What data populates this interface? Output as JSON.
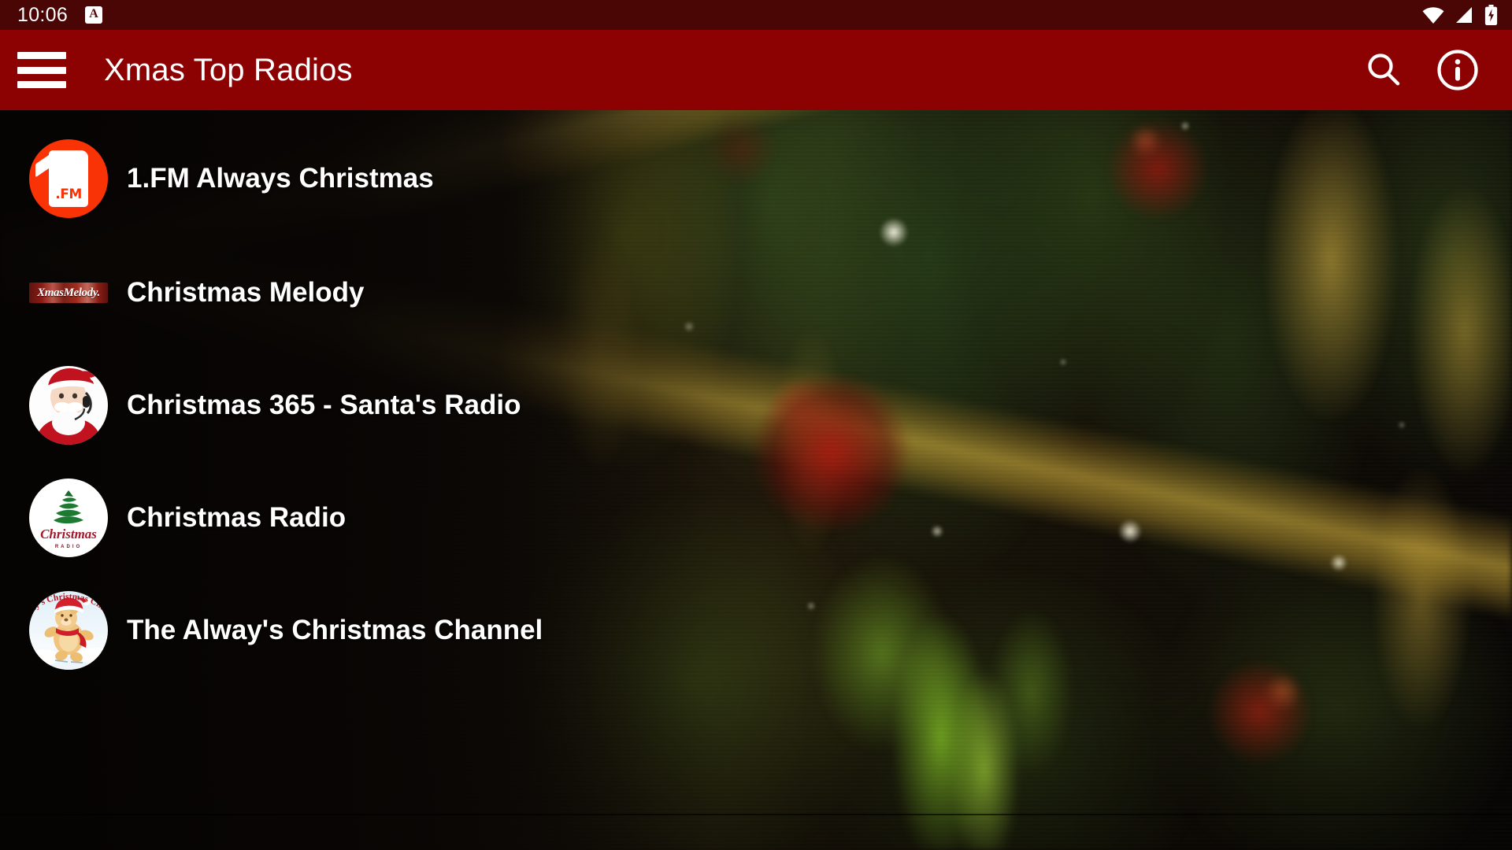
{
  "status_bar": {
    "time": "10:06",
    "notification_icon_letter": "A",
    "icons": [
      "wifi-icon",
      "cellular-signal-icon",
      "battery-charging-icon"
    ],
    "background_color": "#4a0505"
  },
  "app_bar": {
    "menu_icon": "hamburger-menu-icon",
    "title": "Xmas Top Radios",
    "search_icon": "search-icon",
    "info_icon": "info-icon",
    "background_color": "#8c0202",
    "text_color": "#ffffff"
  },
  "list": {
    "items": [
      {
        "name": "1.FM  Always Christmas",
        "logo": "one-fm-logo",
        "logo_text": ".FM",
        "logo_color": "#f93305"
      },
      {
        "name": "Christmas Melody",
        "logo": "xmas-melody-logo",
        "logo_text": "XmasMelody.",
        "logo_color": "#8d1b14"
      },
      {
        "name": "Christmas 365 - Santa's Radio",
        "logo": "santa-radio-logo",
        "logo_color": "#ffffff"
      },
      {
        "name": "Christmas Radio",
        "logo": "christmas-radio-logo",
        "logo_text": "Christmas",
        "logo_subtext": "RADIO",
        "logo_color": "#a3182a"
      },
      {
        "name": "The Alway's Christmas Channel",
        "logo": "alwaysChristmas-teddy-logo",
        "logo_text": "Alway's Christmas Channel",
        "logo_color": "#b01725"
      }
    ]
  },
  "background": {
    "description": "blurred christmas tree photo",
    "dominant_colors": [
      "#0a0705",
      "#2c4418",
      "#b08e2c",
      "#a8180e"
    ]
  }
}
